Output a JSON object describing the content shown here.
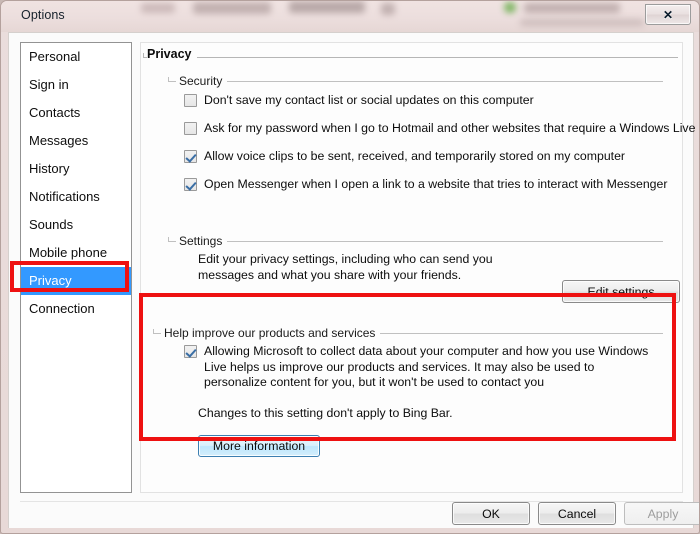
{
  "window": {
    "title": "Options",
    "close_label": "✕",
    "close_icon": "close-icon"
  },
  "sidebar": {
    "items": [
      {
        "label": "Personal",
        "selected": false
      },
      {
        "label": "Sign in",
        "selected": false
      },
      {
        "label": "Contacts",
        "selected": false
      },
      {
        "label": "Messages",
        "selected": false
      },
      {
        "label": "History",
        "selected": false
      },
      {
        "label": "Notifications",
        "selected": false
      },
      {
        "label": "Sounds",
        "selected": false
      },
      {
        "label": "Mobile phone",
        "selected": false
      },
      {
        "label": "Privacy",
        "selected": true
      },
      {
        "label": "Connection",
        "selected": false
      }
    ]
  },
  "content": {
    "page_title": "Privacy",
    "security": {
      "group_label": "Security",
      "checkboxes": [
        {
          "label": "Don't save my contact list or social updates on this computer",
          "checked": false
        },
        {
          "label": "Ask for my password when I go to Hotmail and other websites that require a Windows Live ID",
          "checked": false
        },
        {
          "label": "Allow voice clips to be sent, received, and temporarily stored on my computer",
          "checked": true
        },
        {
          "label": "Open Messenger when I open a link to a website that tries to interact with Messenger",
          "checked": true
        }
      ]
    },
    "settings": {
      "group_label": "Settings",
      "description": "Edit your privacy settings, including who can send you messages and what you share with your friends.",
      "edit_button": "Edit settings"
    },
    "improve": {
      "group_label": "Help improve our products and services",
      "checkbox": {
        "label": "Allowing Microsoft to collect data about your computer and how you use Windows Live helps us improve our products and services. It may also be used to personalize content for you, but it won't be used to contact you",
        "checked": true
      },
      "note": "Changes to this setting don't apply to Bing Bar.",
      "more_button": "More information"
    }
  },
  "footer": {
    "ok": "OK",
    "cancel": "Cancel",
    "apply": "Apply",
    "apply_disabled": true
  },
  "annotations": {
    "accent_color": "#ee1111",
    "selection_color": "#3399ff"
  }
}
